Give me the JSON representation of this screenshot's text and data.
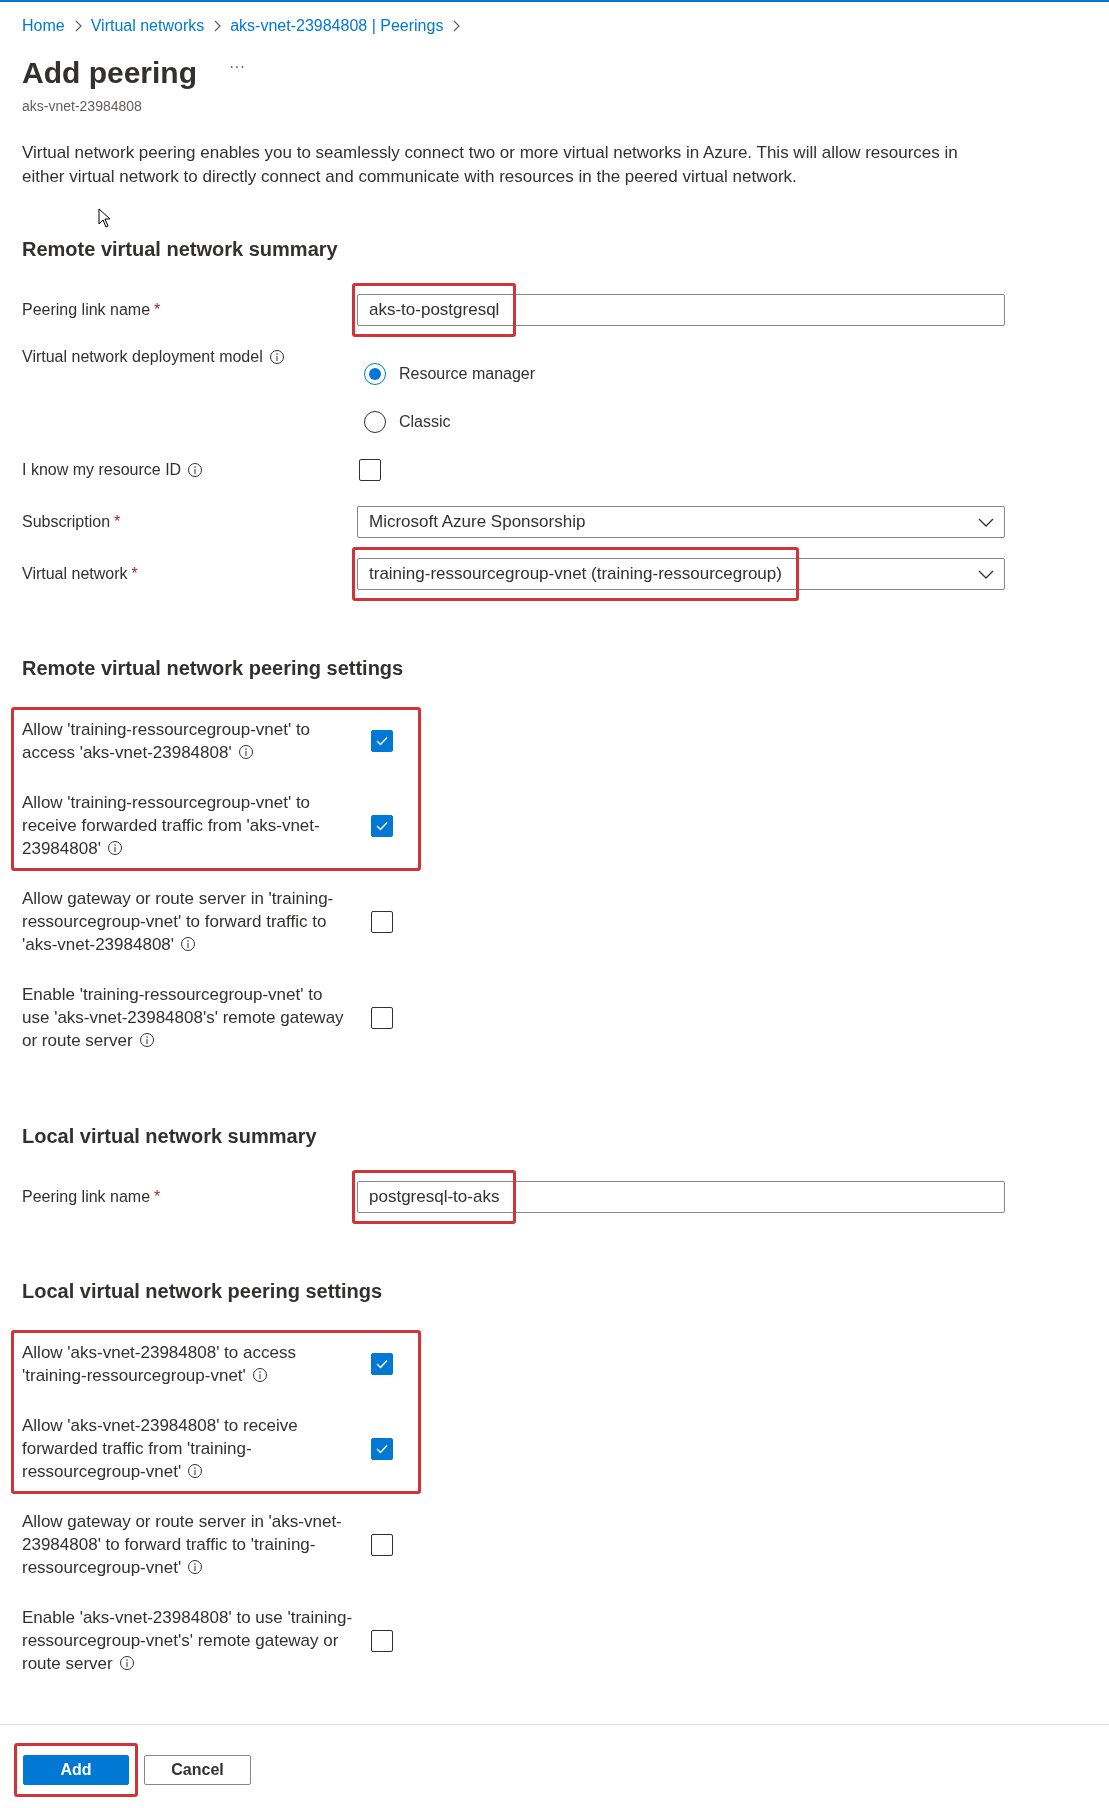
{
  "breadcrumb": [
    "Home",
    "Virtual networks",
    "aks-vnet-23984808 | Peerings"
  ],
  "title": "Add peering",
  "more": "···",
  "subtitle": "aks-vnet-23984808",
  "description": "Virtual network peering enables you to seamlessly connect two or more virtual networks in Azure. This will allow resources in either virtual network to directly connect and communicate with resources in the peered virtual network.",
  "sections": [
    {
      "kind": "fields",
      "heading": "Remote virtual network summary",
      "fields": [
        {
          "kind": "text",
          "label": "Peering link name",
          "required_mark": "*",
          "value": "aks-to-postgresql",
          "highlighted": true
        },
        {
          "kind": "radio",
          "label": "Virtual network deployment model",
          "info": true,
          "options": [
            {
              "label": "Resource manager",
              "selected": true
            },
            {
              "label": "Classic",
              "selected": false
            }
          ]
        },
        {
          "kind": "checkbox",
          "label": "I know my resource ID",
          "info": true,
          "checked": false
        },
        {
          "kind": "dropdown",
          "label": "Subscription",
          "required_mark": "*",
          "value": "Microsoft Azure Sponsorship",
          "highlighted": false
        },
        {
          "kind": "dropdown",
          "label": "Virtual network",
          "required_mark": "*",
          "value": "training-ressourcegroup-vnet (training-ressourcegroup)",
          "highlighted": true
        }
      ]
    },
    {
      "kind": "options",
      "heading": "Remote virtual network peering settings",
      "options": [
        {
          "label": "Allow 'training-ressourcegroup-vnet' to access 'aks-vnet-23984808'",
          "checked": true,
          "highlighted": true
        },
        {
          "label": "Allow 'training-ressourcegroup-vnet' to receive forwarded traffic from 'aks-vnet-23984808'",
          "checked": true,
          "highlighted": true
        },
        {
          "label": "Allow gateway or route server in 'training-ressourcegroup-vnet' to forward traffic to 'aks-vnet-23984808'",
          "checked": false,
          "highlighted": false
        },
        {
          "label": "Enable 'training-ressourcegroup-vnet' to use 'aks-vnet-23984808's' remote gateway or route server",
          "checked": false,
          "highlighted": false
        }
      ]
    },
    {
      "kind": "fields",
      "heading": "Local virtual network summary",
      "fields": [
        {
          "kind": "text",
          "label": "Peering link name",
          "required_mark": "*",
          "value": "postgresql-to-aks",
          "highlighted": true
        }
      ]
    },
    {
      "kind": "options",
      "heading": "Local virtual network peering settings",
      "options": [
        {
          "label": "Allow 'aks-vnet-23984808' to access 'training-ressourcegroup-vnet'",
          "checked": true,
          "highlighted": true
        },
        {
          "label": "Allow 'aks-vnet-23984808' to receive forwarded traffic from 'training-ressourcegroup-vnet'",
          "checked": true,
          "highlighted": true
        },
        {
          "label": "Allow gateway or route server in 'aks-vnet-23984808' to forward traffic to 'training-ressourcegroup-vnet'",
          "checked": false,
          "highlighted": false
        },
        {
          "label": "Enable 'aks-vnet-23984808' to use 'training-ressourcegroup-vnet's' remote gateway or route server",
          "checked": false,
          "highlighted": false
        }
      ]
    }
  ],
  "buttons": [
    {
      "label": "Add",
      "kind": "primary",
      "highlighted": true
    },
    {
      "label": "Cancel",
      "kind": "secondary",
      "highlighted": false
    }
  ]
}
